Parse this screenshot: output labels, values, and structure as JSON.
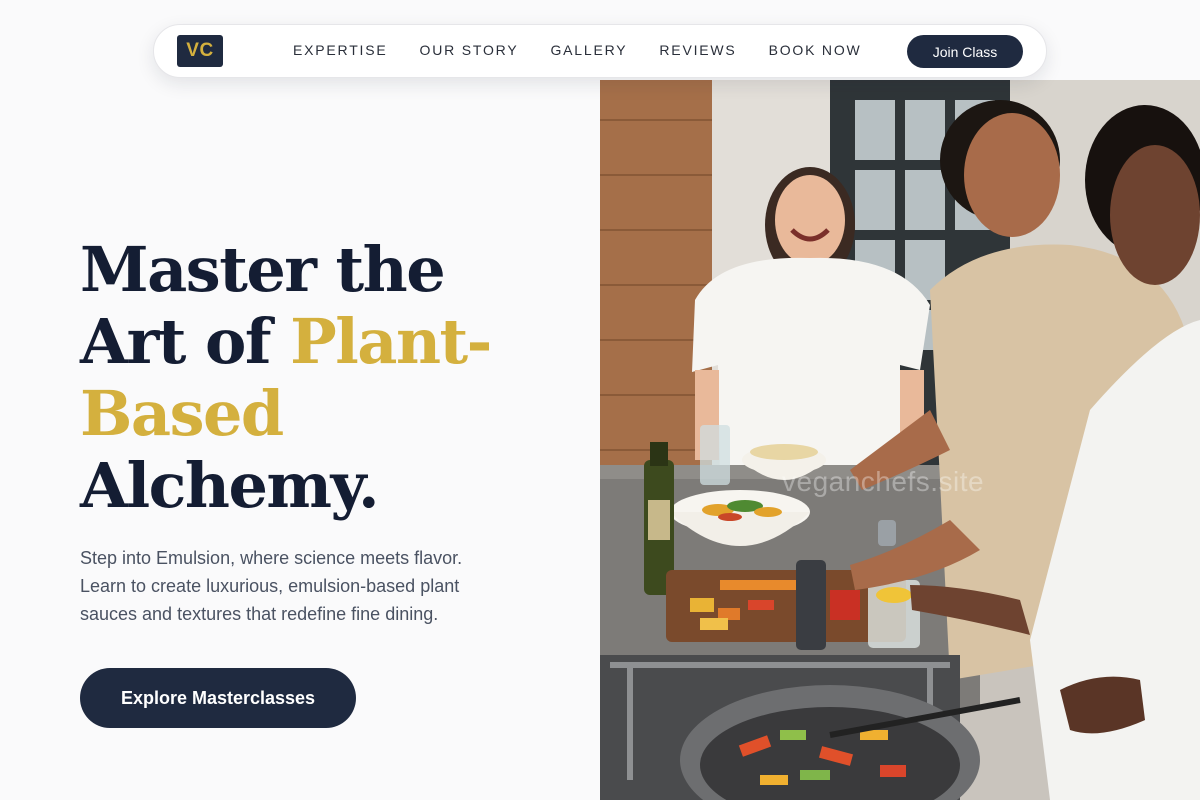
{
  "nav": {
    "logo": "VC",
    "links": [
      "EXPERTISE",
      "OUR STORY",
      "GALLERY",
      "REVIEWS",
      "BOOK NOW"
    ],
    "join_label": "Join Class"
  },
  "hero": {
    "headline_line1": "Master the",
    "headline_art": "Art of ",
    "headline_gold": "Plant-Based",
    "headline_gold_1": "Plant-",
    "headline_gold_2": "Based",
    "headline_last": "Alchemy.",
    "subtext": "Step into Emulsion, where science meets flavor. Learn to create luxurious, emulsion-based plant sauces and textures that redefine fine dining.",
    "cta_label": "Explore Masterclasses",
    "photo_watermark": "veganchefs.site"
  },
  "colors": {
    "navy": "#1f2a40",
    "gold": "#d4b03e",
    "text": "#141d33",
    "muted": "#4a5262"
  }
}
